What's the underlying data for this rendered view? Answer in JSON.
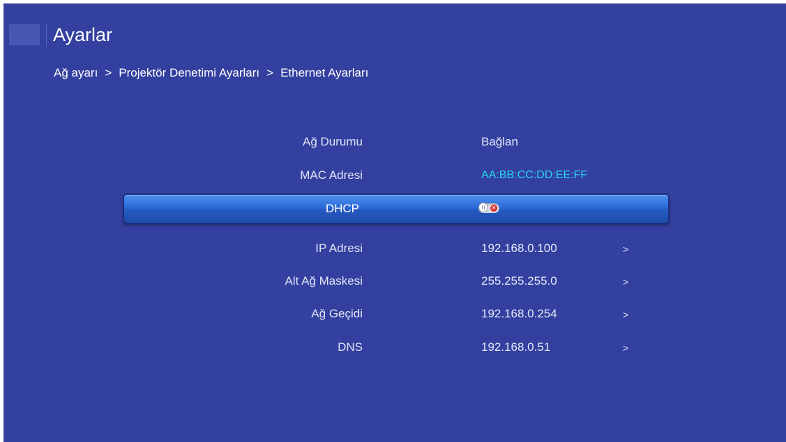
{
  "header": {
    "title": "Ayarlar"
  },
  "breadcrumb": {
    "items": [
      "Ağ ayarı",
      "Projektör Denetimi Ayarları",
      "Ethernet Ayarları"
    ],
    "separator": ">"
  },
  "settings": {
    "rows": [
      {
        "label": "Ağ Durumu",
        "value": "Bağlan"
      },
      {
        "label": "MAC Adresi",
        "value": "AA:BB:CC:DD:EE:FF"
      },
      {
        "label": "DHCP",
        "toggle": "off",
        "toggle_icon": "close-icon"
      },
      {
        "label": "IP Adresi",
        "value": "192.168.0.100",
        "arrow": ">"
      },
      {
        "label": "Alt Ağ Maskesi",
        "value": "255.255.255.0",
        "arrow": ">"
      },
      {
        "label": "Ağ Geçidi",
        "value": "192.168.0.254",
        "arrow": ">"
      },
      {
        "label": "DNS",
        "value": "192.168.0.51",
        "arrow": ">"
      }
    ]
  },
  "colors": {
    "background": "#3340a0",
    "highlight": "#2d6ad8",
    "mac_value": "#28d8ee",
    "toggle_off": "#e03030"
  }
}
